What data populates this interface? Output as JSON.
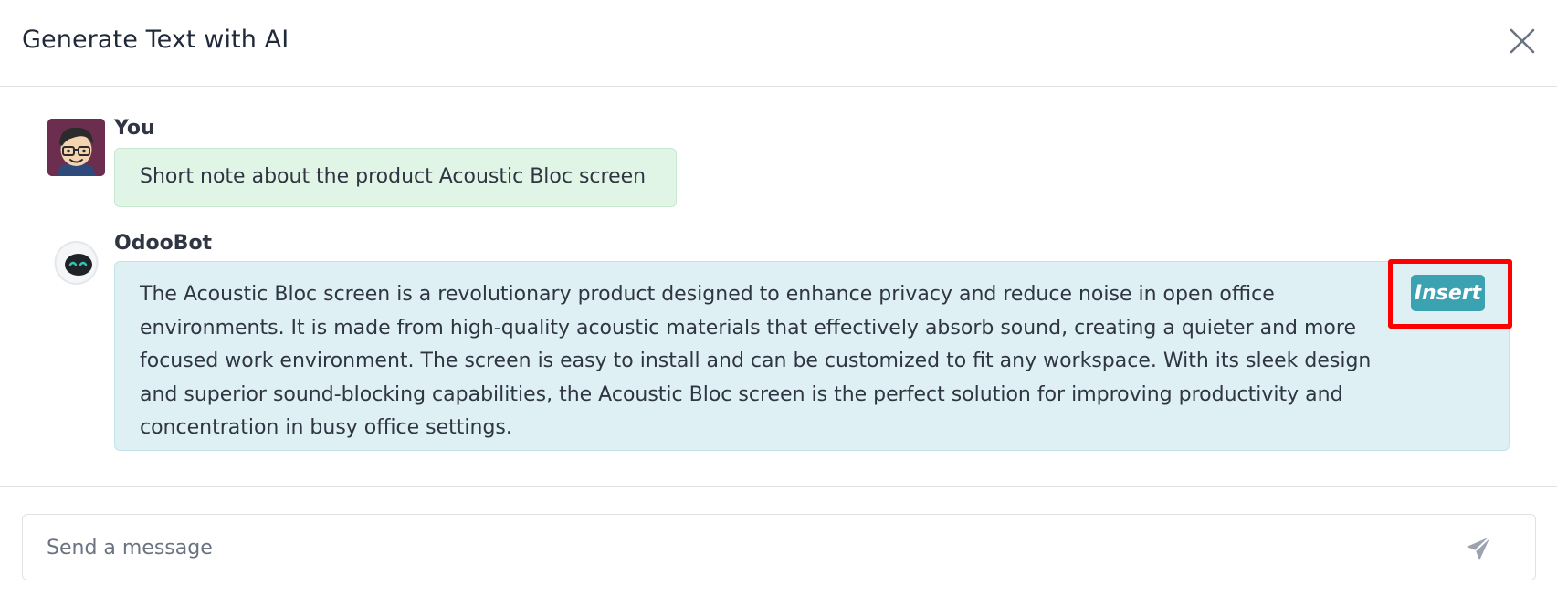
{
  "dialog": {
    "title": "Generate Text with AI"
  },
  "messages": [
    {
      "author": "You",
      "text": "Short note about the product Acoustic Bloc screen"
    },
    {
      "author": "OdooBot",
      "text": "The Acoustic Bloc screen is a revolutionary product designed to enhance privacy and reduce noise in open office environments. It is made from high-quality acoustic materials that effectively absorb sound, creating a quieter and more focused work environment. The screen is easy to install and can be customized to fit any workspace. With its sleek design and superior sound-blocking capabilities, the Acoustic Bloc screen is the perfect solution for improving productivity and concentration in busy office settings.",
      "insert_label": "Insert"
    }
  ],
  "composer": {
    "placeholder": "Send a message"
  },
  "icons": {
    "close": "close-icon",
    "send": "send-icon"
  },
  "colors": {
    "user_bubble": "#e1f5e7",
    "bot_bubble": "#dff0f5",
    "insert_button": "#3aa2b0",
    "highlight": "#ff0000"
  }
}
